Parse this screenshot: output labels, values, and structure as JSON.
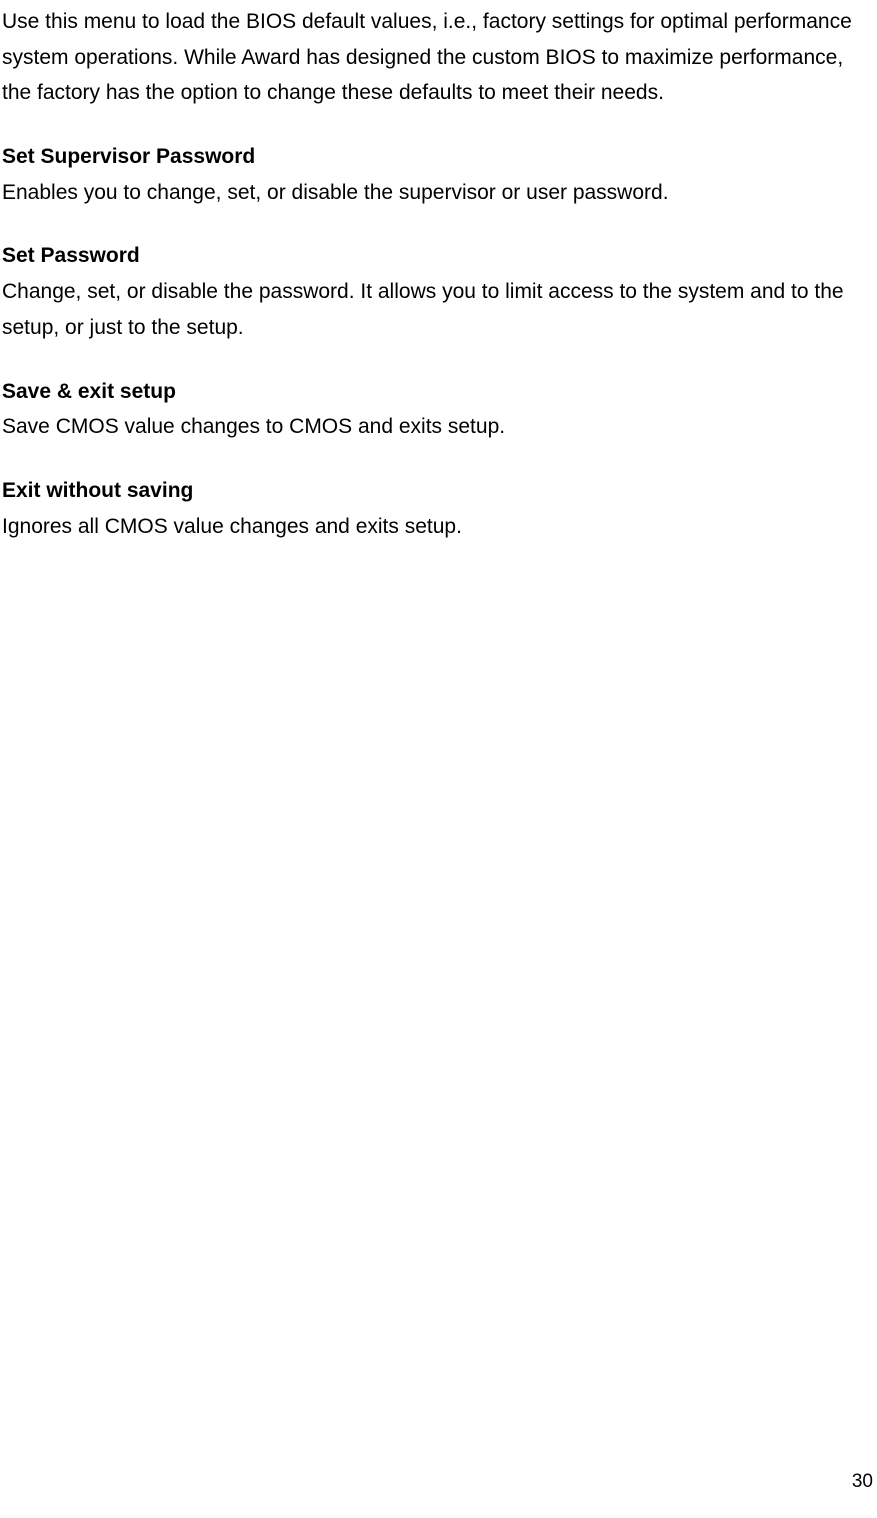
{
  "intro": "Use this menu to load the BIOS default values, i.e., factory settings for optimal performance system operations. While Award has designed the custom BIOS to maximize performance, the factory has the option to change these defaults to meet their needs.",
  "sections": [
    {
      "heading": "Set Supervisor Password",
      "body": "Enables you to change, set, or disable the supervisor or user password."
    },
    {
      "heading": "Set Password",
      "body": "Change, set, or disable the password. It allows you to limit access to the system and to the setup, or just to the setup."
    },
    {
      "heading": "Save & exit setup",
      "body": "Save CMOS value changes to CMOS and exits setup."
    },
    {
      "heading": "Exit without saving",
      "body": "Ignores all CMOS value changes and exits setup."
    }
  ],
  "page_number": "30"
}
